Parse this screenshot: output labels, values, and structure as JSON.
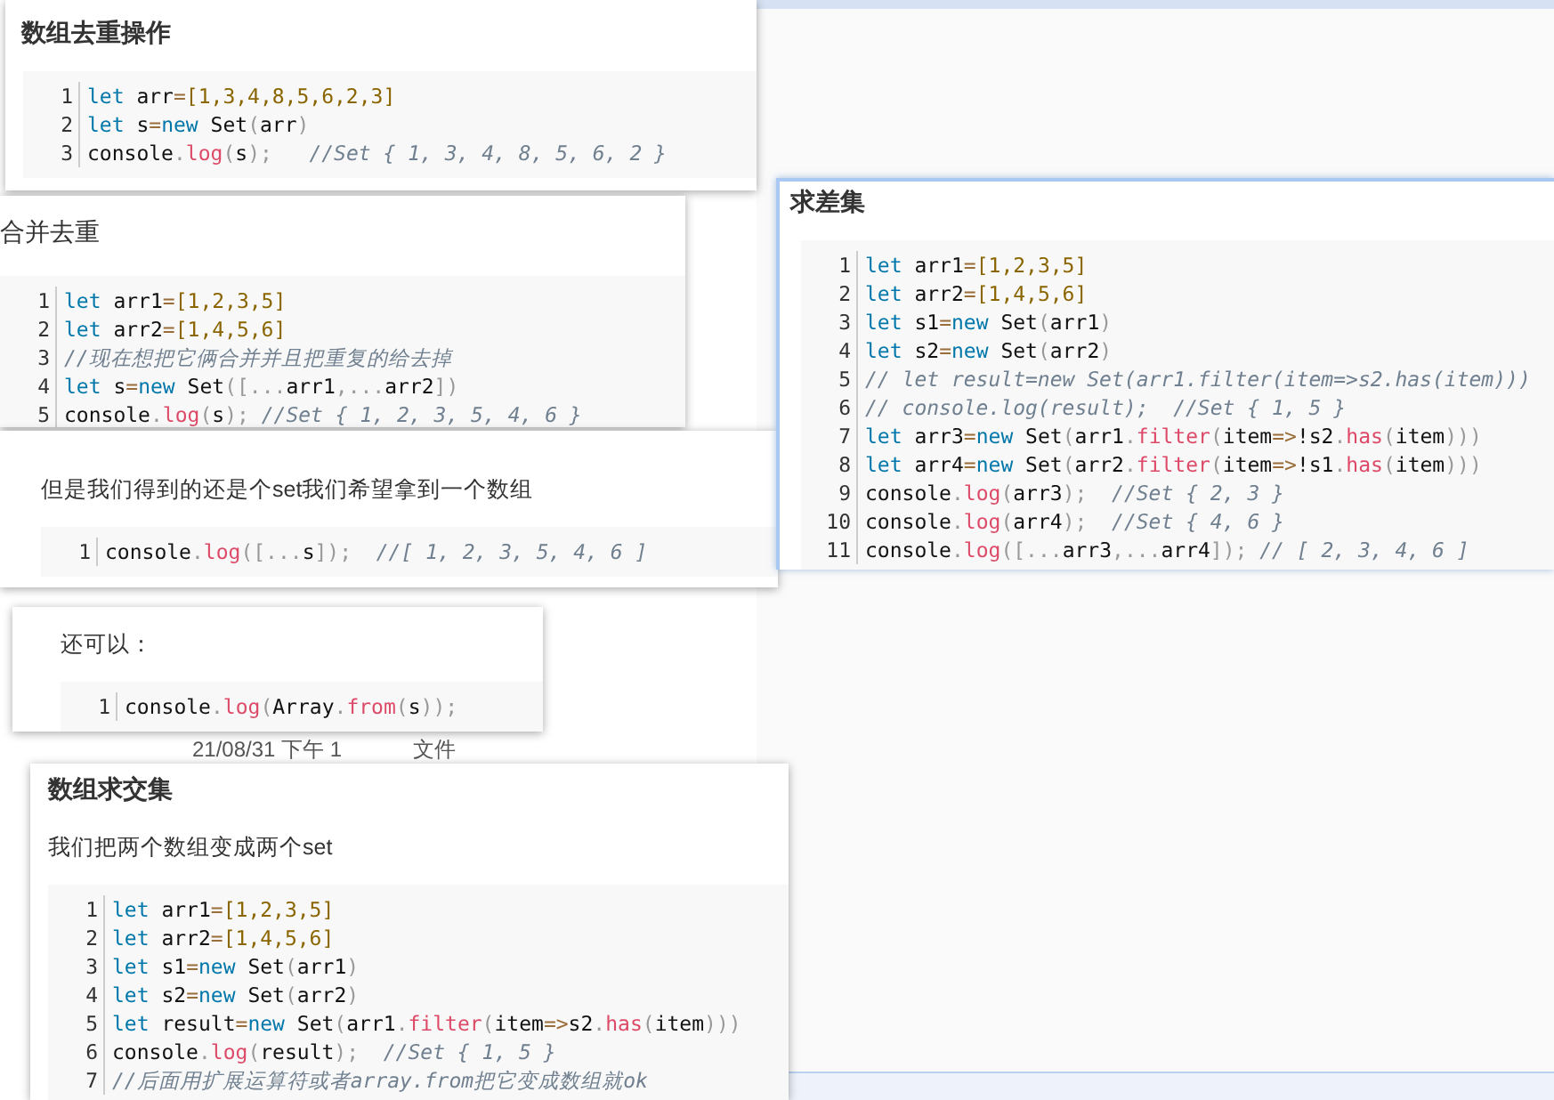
{
  "background_row": {
    "date": "21/08/31 下午 1",
    "type": "文件"
  },
  "cards": [
    {
      "title": "数组去重操作",
      "title_bold": true,
      "selected": false,
      "lines": [
        {
          "number": "1",
          "tokens": [
            {
              "kind": "k",
              "text": "let"
            },
            {
              "kind": "t",
              "text": " arr"
            },
            {
              "kind": "o",
              "text": "="
            },
            {
              "kind": "n",
              "text": "[1,3,4,8,5,6,2,3]"
            }
          ]
        },
        {
          "number": "2",
          "tokens": [
            {
              "kind": "k",
              "text": "let"
            },
            {
              "kind": "t",
              "text": " s"
            },
            {
              "kind": "o",
              "text": "="
            },
            {
              "kind": "k",
              "text": "new"
            },
            {
              "kind": "t",
              "text": " Set"
            },
            {
              "kind": "p",
              "text": "("
            },
            {
              "kind": "t",
              "text": "arr"
            },
            {
              "kind": "p",
              "text": ")"
            }
          ]
        },
        {
          "number": "3",
          "tokens": [
            {
              "kind": "t",
              "text": "console"
            },
            {
              "kind": "p",
              "text": "."
            },
            {
              "kind": "f",
              "text": "log"
            },
            {
              "kind": "p",
              "text": "("
            },
            {
              "kind": "t",
              "text": "s"
            },
            {
              "kind": "p",
              "text": ");"
            },
            {
              "kind": "c",
              "text": "   //Set { 1, 3, 4, 8, 5, 6, 2 }"
            }
          ]
        }
      ]
    },
    {
      "title": "合并去重",
      "title_bold": false,
      "selected": false,
      "lines": [
        {
          "number": "1",
          "tokens": [
            {
              "kind": "k",
              "text": "let"
            },
            {
              "kind": "t",
              "text": " arr1"
            },
            {
              "kind": "o",
              "text": "="
            },
            {
              "kind": "n",
              "text": "[1,2,3,5]"
            }
          ]
        },
        {
          "number": "2",
          "tokens": [
            {
              "kind": "k",
              "text": "let"
            },
            {
              "kind": "t",
              "text": " arr2"
            },
            {
              "kind": "o",
              "text": "="
            },
            {
              "kind": "n",
              "text": "[1,4,5,6]"
            }
          ]
        },
        {
          "number": "3",
          "tokens": [
            {
              "kind": "c",
              "text": "//现在想把它俩合并并且把重复的给去掉"
            }
          ]
        },
        {
          "number": "4",
          "tokens": [
            {
              "kind": "k",
              "text": "let"
            },
            {
              "kind": "t",
              "text": " s"
            },
            {
              "kind": "o",
              "text": "="
            },
            {
              "kind": "k",
              "text": "new"
            },
            {
              "kind": "t",
              "text": " Set"
            },
            {
              "kind": "p",
              "text": "([..."
            },
            {
              "kind": "t",
              "text": "arr1"
            },
            {
              "kind": "p",
              "text": ",..."
            },
            {
              "kind": "t",
              "text": "arr2"
            },
            {
              "kind": "p",
              "text": "])"
            }
          ]
        },
        {
          "number": "5",
          "tokens": [
            {
              "kind": "t",
              "text": "console"
            },
            {
              "kind": "p",
              "text": "."
            },
            {
              "kind": "f",
              "text": "log"
            },
            {
              "kind": "p",
              "text": "("
            },
            {
              "kind": "t",
              "text": "s"
            },
            {
              "kind": "p",
              "text": ");"
            },
            {
              "kind": "c",
              "text": " //Set { 1, 2, 3, 5, 4, 6 }"
            }
          ]
        }
      ]
    },
    {
      "paragraph": "但是我们得到的还是个set我们希望拿到一个数组",
      "selected": false,
      "lines": [
        {
          "number": "1",
          "tokens": [
            {
              "kind": "t",
              "text": "console"
            },
            {
              "kind": "p",
              "text": "."
            },
            {
              "kind": "f",
              "text": "log"
            },
            {
              "kind": "p",
              "text": "([..."
            },
            {
              "kind": "t",
              "text": "s"
            },
            {
              "kind": "p",
              "text": "]);"
            },
            {
              "kind": "c",
              "text": "  //[ 1, 2, 3, 5, 4, 6 ]"
            }
          ]
        }
      ]
    },
    {
      "paragraph": "还可以：",
      "selected": false,
      "lines": [
        {
          "number": "1",
          "tokens": [
            {
              "kind": "t",
              "text": "console"
            },
            {
              "kind": "p",
              "text": "."
            },
            {
              "kind": "f",
              "text": "log"
            },
            {
              "kind": "p",
              "text": "("
            },
            {
              "kind": "t",
              "text": "Array"
            },
            {
              "kind": "p",
              "text": "."
            },
            {
              "kind": "f",
              "text": "from"
            },
            {
              "kind": "p",
              "text": "("
            },
            {
              "kind": "t",
              "text": "s"
            },
            {
              "kind": "p",
              "text": "));"
            }
          ]
        }
      ]
    },
    {
      "title": "数组求交集",
      "title_bold": true,
      "paragraph": "我们把两个数组变成两个set",
      "selected": false,
      "lines": [
        {
          "number": "1",
          "tokens": [
            {
              "kind": "k",
              "text": "let"
            },
            {
              "kind": "t",
              "text": " arr1"
            },
            {
              "kind": "o",
              "text": "="
            },
            {
              "kind": "n",
              "text": "[1,2,3,5]"
            }
          ]
        },
        {
          "number": "2",
          "tokens": [
            {
              "kind": "k",
              "text": "let"
            },
            {
              "kind": "t",
              "text": " arr2"
            },
            {
              "kind": "o",
              "text": "="
            },
            {
              "kind": "n",
              "text": "[1,4,5,6]"
            }
          ]
        },
        {
          "number": "3",
          "tokens": [
            {
              "kind": "k",
              "text": "let"
            },
            {
              "kind": "t",
              "text": " s1"
            },
            {
              "kind": "o",
              "text": "="
            },
            {
              "kind": "k",
              "text": "new"
            },
            {
              "kind": "t",
              "text": " Set"
            },
            {
              "kind": "p",
              "text": "("
            },
            {
              "kind": "t",
              "text": "arr1"
            },
            {
              "kind": "p",
              "text": ")"
            }
          ]
        },
        {
          "number": "4",
          "tokens": [
            {
              "kind": "k",
              "text": "let"
            },
            {
              "kind": "t",
              "text": " s2"
            },
            {
              "kind": "o",
              "text": "="
            },
            {
              "kind": "k",
              "text": "new"
            },
            {
              "kind": "t",
              "text": " Set"
            },
            {
              "kind": "p",
              "text": "("
            },
            {
              "kind": "t",
              "text": "arr2"
            },
            {
              "kind": "p",
              "text": ")"
            }
          ]
        },
        {
          "number": "5",
          "tokens": [
            {
              "kind": "k",
              "text": "let"
            },
            {
              "kind": "t",
              "text": " result"
            },
            {
              "kind": "o",
              "text": "="
            },
            {
              "kind": "k",
              "text": "new"
            },
            {
              "kind": "t",
              "text": " Set"
            },
            {
              "kind": "p",
              "text": "("
            },
            {
              "kind": "t",
              "text": "arr1"
            },
            {
              "kind": "p",
              "text": "."
            },
            {
              "kind": "f",
              "text": "filter"
            },
            {
              "kind": "p",
              "text": "("
            },
            {
              "kind": "t",
              "text": "item"
            },
            {
              "kind": "o",
              "text": "=>"
            },
            {
              "kind": "t",
              "text": "s2"
            },
            {
              "kind": "p",
              "text": "."
            },
            {
              "kind": "f",
              "text": "has"
            },
            {
              "kind": "p",
              "text": "("
            },
            {
              "kind": "t",
              "text": "item"
            },
            {
              "kind": "p",
              "text": ")))"
            }
          ]
        },
        {
          "number": "6",
          "tokens": [
            {
              "kind": "t",
              "text": "console"
            },
            {
              "kind": "p",
              "text": "."
            },
            {
              "kind": "f",
              "text": "log"
            },
            {
              "kind": "p",
              "text": "("
            },
            {
              "kind": "t",
              "text": "result"
            },
            {
              "kind": "p",
              "text": ");"
            },
            {
              "kind": "c",
              "text": "  //Set { 1, 5 }"
            }
          ]
        },
        {
          "number": "7",
          "tokens": [
            {
              "kind": "c",
              "text": "//后面用扩展运算符或者array.from把它变成数组就ok"
            }
          ]
        }
      ]
    },
    {
      "title": "求差集",
      "title_bold": true,
      "selected": true,
      "lines": [
        {
          "number": "1",
          "tokens": [
            {
              "kind": "k",
              "text": "let"
            },
            {
              "kind": "t",
              "text": " arr1"
            },
            {
              "kind": "o",
              "text": "="
            },
            {
              "kind": "n",
              "text": "[1,2,3,5]"
            }
          ]
        },
        {
          "number": "2",
          "tokens": [
            {
              "kind": "k",
              "text": "let"
            },
            {
              "kind": "t",
              "text": " arr2"
            },
            {
              "kind": "o",
              "text": "="
            },
            {
              "kind": "n",
              "text": "[1,4,5,6]"
            }
          ]
        },
        {
          "number": "3",
          "tokens": [
            {
              "kind": "k",
              "text": "let"
            },
            {
              "kind": "t",
              "text": " s1"
            },
            {
              "kind": "o",
              "text": "="
            },
            {
              "kind": "k",
              "text": "new"
            },
            {
              "kind": "t",
              "text": " Set"
            },
            {
              "kind": "p",
              "text": "("
            },
            {
              "kind": "t",
              "text": "arr1"
            },
            {
              "kind": "p",
              "text": ")"
            }
          ]
        },
        {
          "number": "4",
          "tokens": [
            {
              "kind": "k",
              "text": "let"
            },
            {
              "kind": "t",
              "text": " s2"
            },
            {
              "kind": "o",
              "text": "="
            },
            {
              "kind": "k",
              "text": "new"
            },
            {
              "kind": "t",
              "text": " Set"
            },
            {
              "kind": "p",
              "text": "("
            },
            {
              "kind": "t",
              "text": "arr2"
            },
            {
              "kind": "p",
              "text": ")"
            }
          ]
        },
        {
          "number": "5",
          "tokens": [
            {
              "kind": "c",
              "text": "// let result=new Set(arr1.filter(item=>s2.has(item)))"
            }
          ]
        },
        {
          "number": "6",
          "tokens": [
            {
              "kind": "c",
              "text": "// console.log(result);  //Set { 1, 5 }"
            }
          ]
        },
        {
          "number": "7",
          "tokens": [
            {
              "kind": "k",
              "text": "let"
            },
            {
              "kind": "t",
              "text": " arr3"
            },
            {
              "kind": "o",
              "text": "="
            },
            {
              "kind": "k",
              "text": "new"
            },
            {
              "kind": "t",
              "text": " Set"
            },
            {
              "kind": "p",
              "text": "("
            },
            {
              "kind": "t",
              "text": "arr1"
            },
            {
              "kind": "p",
              "text": "."
            },
            {
              "kind": "f",
              "text": "filter"
            },
            {
              "kind": "p",
              "text": "("
            },
            {
              "kind": "t",
              "text": "item"
            },
            {
              "kind": "o",
              "text": "=>"
            },
            {
              "kind": "t",
              "text": "!s2"
            },
            {
              "kind": "p",
              "text": "."
            },
            {
              "kind": "f",
              "text": "has"
            },
            {
              "kind": "p",
              "text": "("
            },
            {
              "kind": "t",
              "text": "item"
            },
            {
              "kind": "p",
              "text": ")))"
            }
          ]
        },
        {
          "number": "8",
          "tokens": [
            {
              "kind": "k",
              "text": "let"
            },
            {
              "kind": "t",
              "text": " arr4"
            },
            {
              "kind": "o",
              "text": "="
            },
            {
              "kind": "k",
              "text": "new"
            },
            {
              "kind": "t",
              "text": " Set"
            },
            {
              "kind": "p",
              "text": "("
            },
            {
              "kind": "t",
              "text": "arr2"
            },
            {
              "kind": "p",
              "text": "."
            },
            {
              "kind": "f",
              "text": "filter"
            },
            {
              "kind": "p",
              "text": "("
            },
            {
              "kind": "t",
              "text": "item"
            },
            {
              "kind": "o",
              "text": "=>"
            },
            {
              "kind": "t",
              "text": "!s1"
            },
            {
              "kind": "p",
              "text": "."
            },
            {
              "kind": "f",
              "text": "has"
            },
            {
              "kind": "p",
              "text": "("
            },
            {
              "kind": "t",
              "text": "item"
            },
            {
              "kind": "p",
              "text": ")))"
            }
          ]
        },
        {
          "number": "9",
          "tokens": [
            {
              "kind": "t",
              "text": "console"
            },
            {
              "kind": "p",
              "text": "."
            },
            {
              "kind": "f",
              "text": "log"
            },
            {
              "kind": "p",
              "text": "("
            },
            {
              "kind": "t",
              "text": "arr3"
            },
            {
              "kind": "p",
              "text": ");"
            },
            {
              "kind": "c",
              "text": "  //Set { 2, 3 }"
            }
          ]
        },
        {
          "number": "10",
          "tokens": [
            {
              "kind": "t",
              "text": "console"
            },
            {
              "kind": "p",
              "text": "."
            },
            {
              "kind": "f",
              "text": "log"
            },
            {
              "kind": "p",
              "text": "("
            },
            {
              "kind": "t",
              "text": "arr4"
            },
            {
              "kind": "p",
              "text": ");"
            },
            {
              "kind": "c",
              "text": "  //Set { 4, 6 }"
            }
          ]
        },
        {
          "number": "11",
          "tokens": [
            {
              "kind": "t",
              "text": "console"
            },
            {
              "kind": "p",
              "text": "."
            },
            {
              "kind": "f",
              "text": "log"
            },
            {
              "kind": "p",
              "text": "([..."
            },
            {
              "kind": "t",
              "text": "arr3"
            },
            {
              "kind": "p",
              "text": ",..."
            },
            {
              "kind": "t",
              "text": "arr4"
            },
            {
              "kind": "p",
              "text": "]);"
            },
            {
              "kind": "c",
              "text": " // [ 2, 3, 4, 6 ]"
            }
          ]
        }
      ]
    }
  ]
}
